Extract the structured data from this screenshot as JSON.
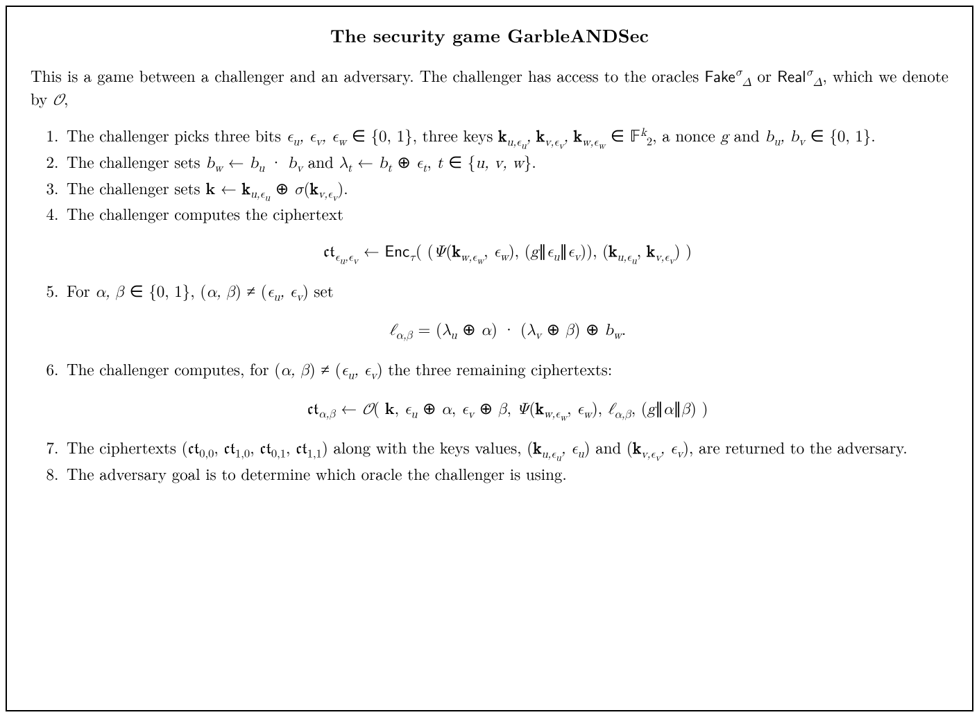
{
  "title": "The security game GarbleANDSec",
  "intro_a": "This is a game between a challenger and an adversary. The challenger has access to the oracles ",
  "intro_fake": "Fake",
  "intro_or": " or ",
  "intro_real": "Real",
  "intro_b": ", which we denote by ",
  "intro_O": "𝒪",
  "intro_c": ",",
  "step1_a": "The challenger picks three bits ",
  "step1_eps": "ϵ",
  "step1_b": " ∈ {0, 1}, three keys ",
  "step1_k": "k",
  "step1_c": " ∈ ",
  "step1_F": "𝔽",
  "step1_d": ", a nonce ",
  "step1_g": "g",
  "step1_e": " and ",
  "step1_f": " ∈ {0, 1}.",
  "step2_a": "The challenger sets ",
  "step2_b": " ← ",
  "step2_c": " · ",
  "step2_d": " and ",
  "step2_lam": "λ",
  "step2_e": " ← ",
  "step2_f": " ⊕ ",
  "step2_g": ", ",
  "step2_t": "t",
  "step2_h": " ∈ {",
  "step2_i": "}.",
  "step3_a": "The challenger sets ",
  "step3_b": " ← ",
  "step3_c": "  ⊕  ",
  "step3_sig": "σ",
  "step3_d": "(",
  "step3_e": ").",
  "step4": "The challenger computes the ciphertext",
  "eq1_ct": "𝔠𝔱",
  "eq1_a": " ← ",
  "eq1_enc": "Enc",
  "eq1_tau": "τ",
  "eq1_b": "(  (",
  "eq1_psi": "Ψ",
  "eq1_c": "(",
  "eq1_d": ", ",
  "eq1_e": "),  (",
  "eq1_f": "∥",
  "eq1_g": ")),  (",
  "eq1_h": ")  )",
  "step5_a": "For ",
  "step5_b": " ∈ {0, 1}, (",
  "step5_c": ") ≠ (",
  "step5_d": ") set",
  "eq2_a": " = (",
  "eq2_b": " ⊕ ",
  "eq2_c": ") · (",
  "eq2_d": ") ⊕ ",
  "eq2_e": ".",
  "step6_a": "The challenger computes, for (",
  "step6_b": ") ≠ (",
  "step6_c": ") the three remaining ciphertexts:",
  "eq3_a": " ← ",
  "eq3_b": "(  ",
  "eq3_c": ",  ",
  "eq3_d": " ⊕ ",
  "eq3_e": "(",
  "eq3_f": ",  ",
  "eq3_g": "),  ",
  "eq3_h": ",  (",
  "eq3_i": "∥",
  "eq3_j": ")  )",
  "step7_a": "The ciphertexts (",
  "step7_b": ") along with the keys values, (",
  "step7_c": ") and (",
  "step7_d": "), are returned to the adversary.",
  "step8": "The adversary goal is to determine which oracle the challenger is using.",
  "sym": {
    "u": "u",
    "v": "v",
    "w": "w",
    "t": "t",
    "alpha": "α",
    "beta": "β",
    "ell": "ℓ",
    "b": "b",
    "k": "k",
    "two": "2",
    "comma": ", "
  },
  "chart_data": null
}
